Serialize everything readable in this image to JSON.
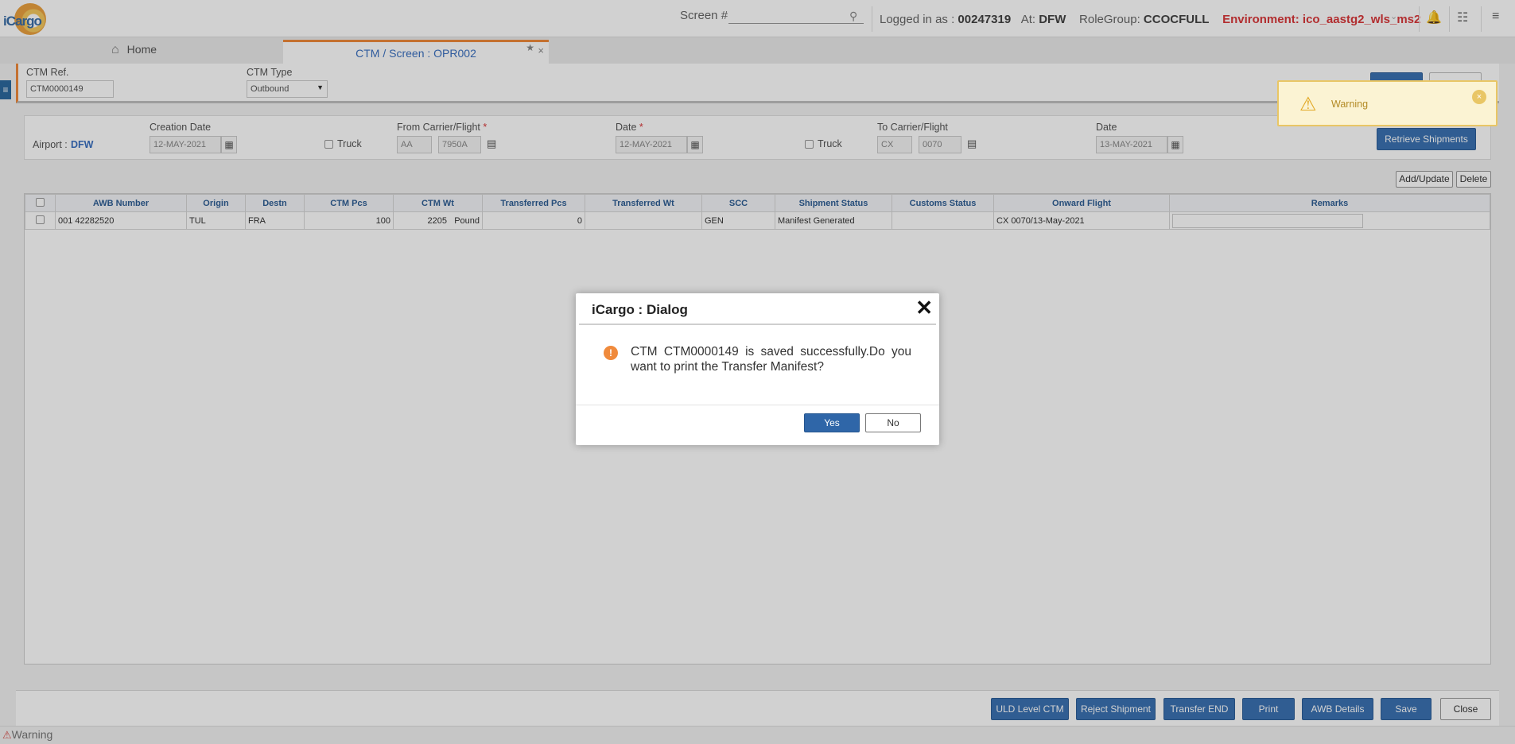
{
  "topbar": {
    "logo_text": "iCargo",
    "screen_label": "Screen #",
    "screen_value": "",
    "logged_in_label": "Logged in as : ",
    "user_id": "00247319",
    "at_label": "At: ",
    "station": "DFW",
    "rolegroup_label": "RoleGroup: ",
    "rolegroup": "CCOCFULL",
    "environment": "Environment: ico_aastg2_wls_ms2"
  },
  "tabs": {
    "home": "Home",
    "active": "CTM / Screen : OPR002"
  },
  "header": {
    "ctm_ref_label": "CTM Ref.",
    "ctm_ref_value": "CTM0000149",
    "ctm_type_label": "CTM Type",
    "ctm_type_value": "Outbound"
  },
  "filters": {
    "airport_label": "Airport :",
    "airport_value": "DFW",
    "creation_date_label": "Creation Date",
    "creation_date_value": "12-MAY-2021",
    "truck_label": "Truck",
    "from_label": "From Carrier/Flight",
    "from_carrier": "AA",
    "from_flight": "7950A",
    "date_label": "Date",
    "date_value": "12-MAY-2021",
    "to_label": "To Carrier/Flight",
    "to_carrier": "CX",
    "to_flight": "0070",
    "to_date_label": "Date",
    "to_date_value": "13-MAY-2021",
    "retrieve_button": "Retrieve Shipments",
    "required_mark": "*"
  },
  "grid_actions": {
    "add_update": "Add/Update",
    "delete": "Delete"
  },
  "table": {
    "columns": [
      "AWB Number",
      "Origin",
      "Destn",
      "CTM Pcs",
      "CTM Wt",
      "Transferred Pcs",
      "Transferred Wt",
      "SCC",
      "Shipment Status",
      "Customs Status",
      "Onward Flight",
      "Remarks"
    ],
    "rows": [
      {
        "awb": "001 42282520",
        "origin": "TUL",
        "destn": "FRA",
        "ctm_pcs": "100",
        "ctm_wt": "2205",
        "ctm_wt_unit": "Pound",
        "transferred_pcs": "0",
        "transferred_wt": "",
        "scc": "GEN",
        "shipment_status": "Manifest Generated",
        "customs_status": "",
        "onward_flight": "CX 0070/13-May-2021",
        "remarks": ""
      }
    ]
  },
  "footer": {
    "uld_level_ctm": "ULD Level CTM",
    "reject_shipment": "Reject Shipment",
    "transfer_end": "Transfer END",
    "print": "Print",
    "awb_details": "AWB Details",
    "save": "Save",
    "close": "Close"
  },
  "status_bar": {
    "text": "Warning"
  },
  "toast": {
    "text": "Warning"
  },
  "dialog": {
    "title": "iCargo : Dialog",
    "message": "CTM CTM0000149 is saved successfully.Do you want to print the Transfer Manifest?",
    "yes": "Yes",
    "no": "No"
  },
  "colors": {
    "primary": "#3b72b2",
    "accent": "#f08a3c",
    "environment": "#d9383a",
    "header_text": "#2f5f95"
  }
}
